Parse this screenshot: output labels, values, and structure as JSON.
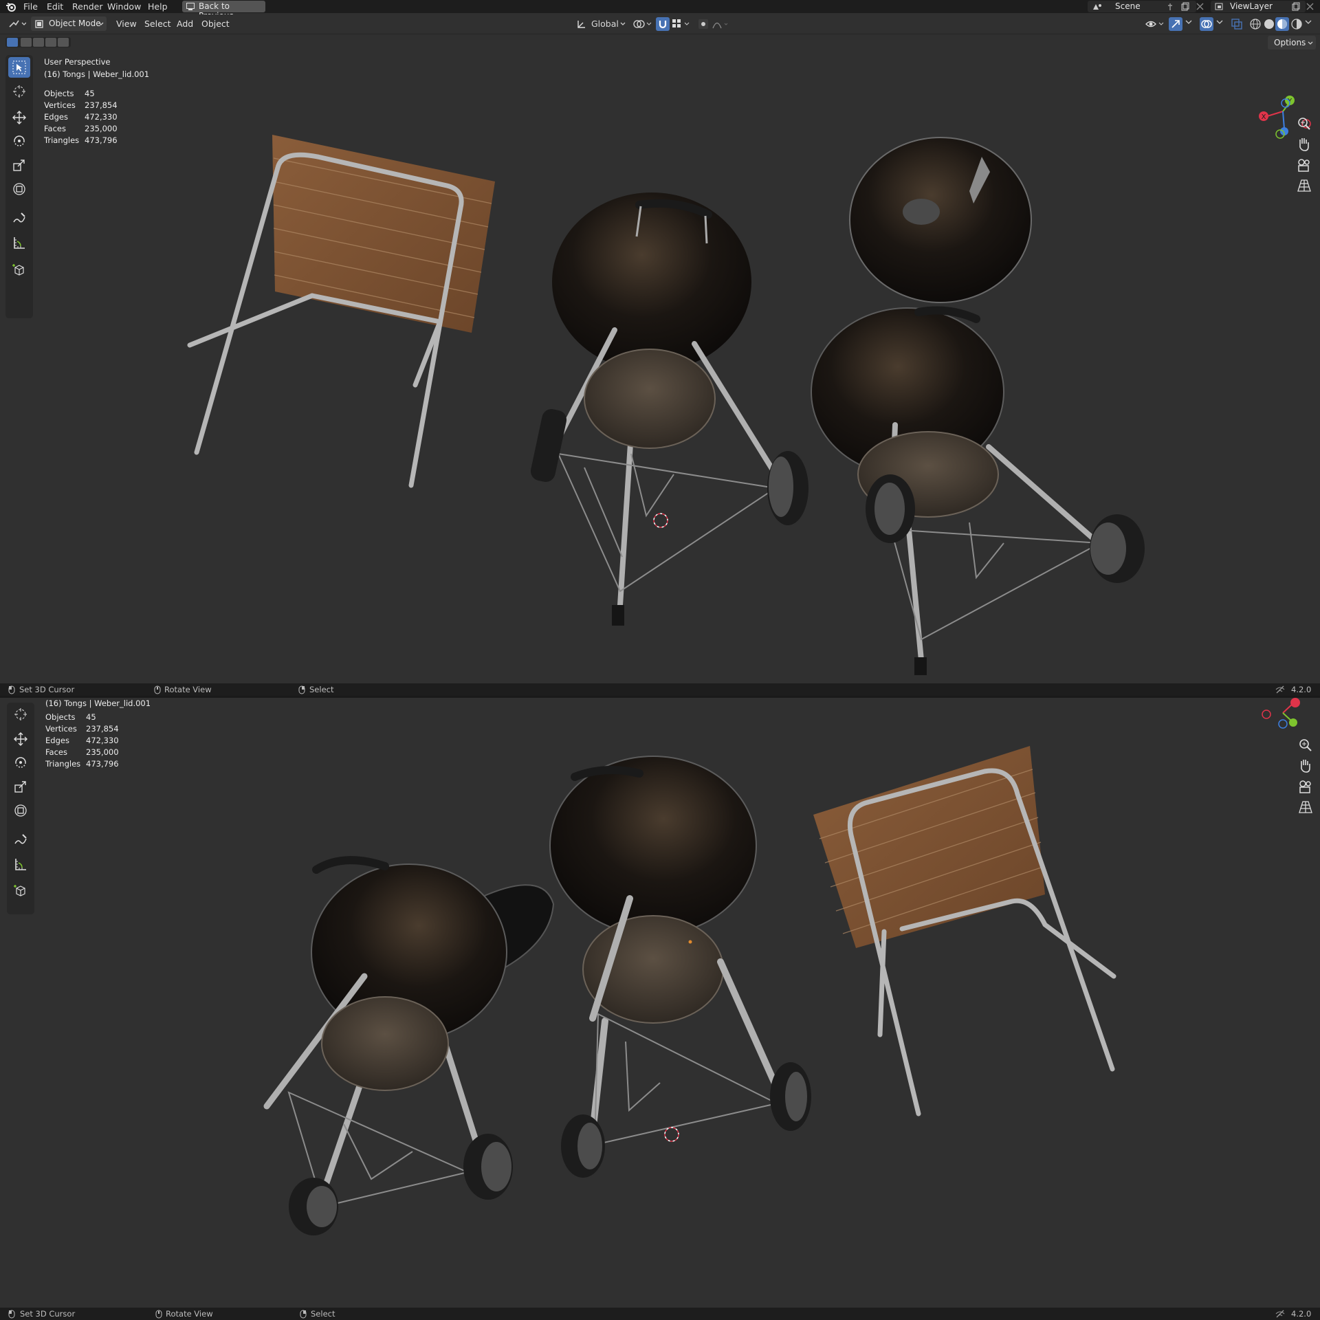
{
  "topbar": {
    "menus": [
      "File",
      "Edit",
      "Render",
      "Window",
      "Help"
    ],
    "back_button": "Back to Previous",
    "scene": "Scene",
    "view_layer": "ViewLayer"
  },
  "header": {
    "mode": "Object Mode",
    "menus": [
      "View",
      "Select",
      "Add",
      "Object"
    ],
    "transform_orientation": "Global",
    "options": "Options"
  },
  "viewport_top": {
    "perspective": "User Perspective",
    "active_object": "(16) Tongs | Weber_lid.001",
    "stats": [
      {
        "label": "Objects",
        "value": "45"
      },
      {
        "label": "Vertices",
        "value": "237,854"
      },
      {
        "label": "Edges",
        "value": "472,330"
      },
      {
        "label": "Faces",
        "value": "235,000"
      },
      {
        "label": "Triangles",
        "value": "473,796"
      }
    ]
  },
  "viewport_bottom": {
    "active_object": "(16) Tongs | Weber_lid.001",
    "stats": [
      {
        "label": "Objects",
        "value": "45"
      },
      {
        "label": "Vertices",
        "value": "237,854"
      },
      {
        "label": "Edges",
        "value": "472,330"
      },
      {
        "label": "Faces",
        "value": "235,000"
      },
      {
        "label": "Triangles",
        "value": "473,796"
      }
    ]
  },
  "statusbar": {
    "set_cursor": "Set 3D Cursor",
    "rotate_view": "Rotate View",
    "select": "Select",
    "version": "4.2.0"
  },
  "gizmo": {
    "x": "X",
    "y": "Y"
  },
  "colors": {
    "accent": "#4772b3",
    "x_axis": "#e0344a",
    "y_axis": "#7ec42e",
    "z_axis": "#3d7fe0"
  }
}
